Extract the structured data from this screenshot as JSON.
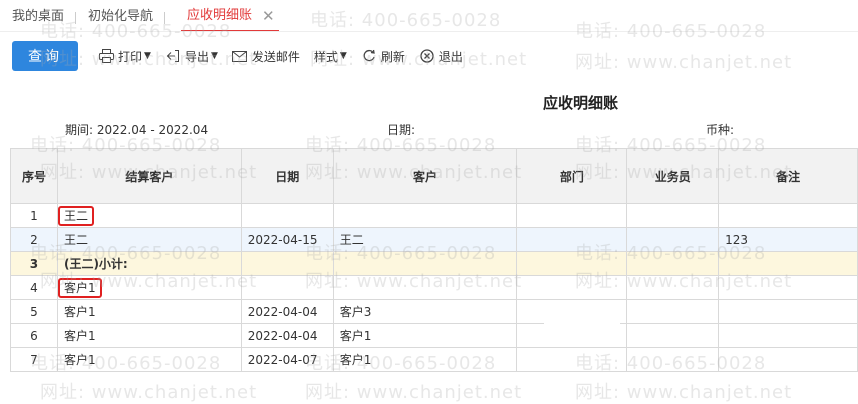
{
  "tabs": [
    {
      "label": "我的桌面"
    },
    {
      "label": "初始化导航"
    },
    {
      "label": "应收明细账",
      "active": true
    }
  ],
  "tab_close_glyph": "✕",
  "toolbar": {
    "query": "查询",
    "print": "打印",
    "export": "导出",
    "send_email": "发送邮件",
    "style": "样式",
    "refresh": "刷新",
    "exit": "退出"
  },
  "icons": {
    "print": "printer-icon",
    "export": "export-icon",
    "email": "email-icon",
    "refresh": "refresh-icon",
    "exit": "exit-icon"
  },
  "report": {
    "title": "应收明细账",
    "period_label": "期间:",
    "period_value": "2022.04 - 2022.04",
    "date_label": "日期:",
    "currency_label": "币种:"
  },
  "table": {
    "headers": [
      "序号",
      "结算客户",
      "日期",
      "客户",
      "部门",
      "业务员",
      "备注"
    ],
    "rows": [
      [
        "1",
        "王二",
        "",
        "",
        "",
        "",
        ""
      ],
      [
        "2",
        "王二",
        "2022-04-15",
        "王二",
        "",
        "",
        "123"
      ],
      [
        "3",
        "(王二)小计:",
        "",
        "",
        "",
        "",
        ""
      ],
      [
        "4",
        "客户1",
        "",
        "",
        "",
        "",
        ""
      ],
      [
        "5",
        "客户1",
        "2022-04-04",
        "客户3",
        "",
        "",
        ""
      ],
      [
        "6",
        "客户1",
        "2022-04-04",
        "客户1",
        "",
        "",
        ""
      ],
      [
        "7",
        "客户1",
        "2022-04-07",
        "客户1",
        "",
        "",
        ""
      ]
    ]
  },
  "watermark": {
    "phone": "电话: 400-665-0028",
    "site": "网址: www.chanjet.net"
  },
  "colors": {
    "accent": "#2e86de",
    "active_tab": "#e23a3a",
    "highlight_box": "#e02020",
    "subtotal_row": "#fdf7de",
    "selected_row": "#eef5fd"
  }
}
